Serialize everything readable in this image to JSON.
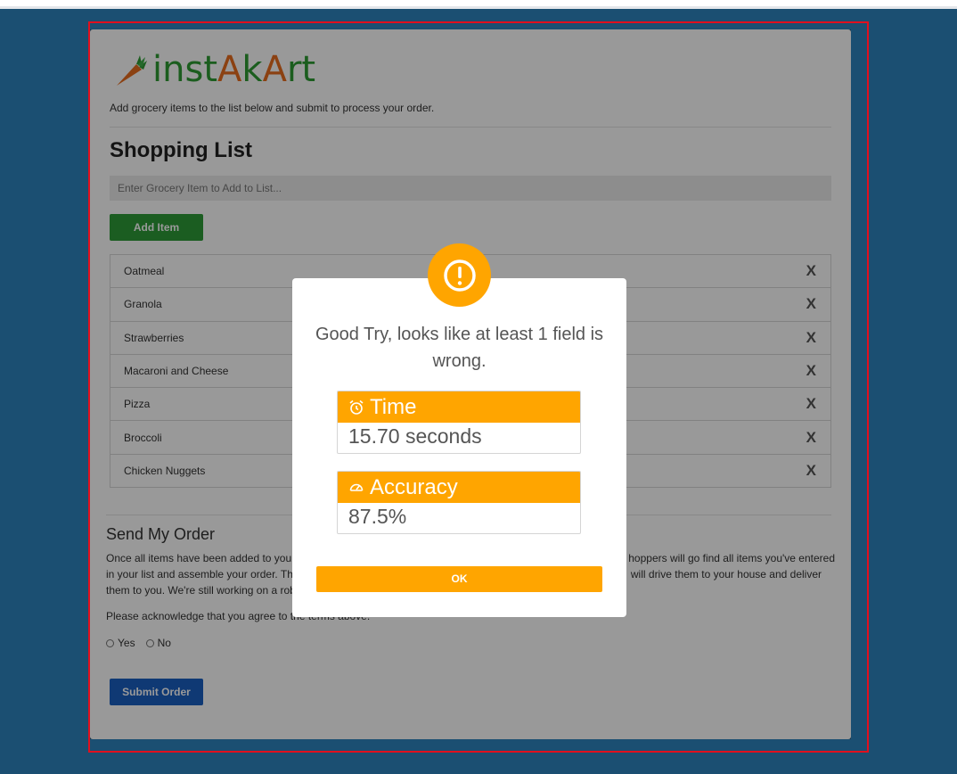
{
  "app": {
    "logo_text": "instAkArt",
    "tagline": "Add grocery items to the list below and submit to process your order."
  },
  "shopping": {
    "title": "Shopping List",
    "input_placeholder": "Enter Grocery Item to Add to List...",
    "add_button": "Add Item",
    "remove_symbol": "X",
    "items": [
      "Oatmeal",
      "Granola",
      "Strawberries",
      "Macaroni and Cheese",
      "Pizza",
      "Broccoli",
      "Chicken Nuggets"
    ]
  },
  "order": {
    "title": "Send My Order",
    "paragraph_visible_left": "Once all items have been added to you",
    "paragraph_visible_right": "hoppers will go find all items you've entered",
    "line2_left": "in your list and assemble your order. Th",
    "line2_right": "will drive them to your house and deliver",
    "line3_left": "them to you. We're still working on a rob",
    "acknowledge": "Please acknowledge that you agree to the terms above.",
    "radio_yes": "Yes",
    "radio_no": "No",
    "submit_button": "Submit Order"
  },
  "modal": {
    "icon": "exclamation-circle-icon",
    "message": "Good Try, looks like at least 1 field is wrong.",
    "time_label": "Time",
    "time_value": "15.70 seconds",
    "accuracy_label": "Accuracy",
    "accuracy_value": "87.5%",
    "ok_button": "OK"
  },
  "colors": {
    "background": "#1b4f72",
    "accent_orange": "#ffa500",
    "add_green": "#2e9c38",
    "submit_blue": "#1a5fc1",
    "frame_red": "#e0101e"
  }
}
